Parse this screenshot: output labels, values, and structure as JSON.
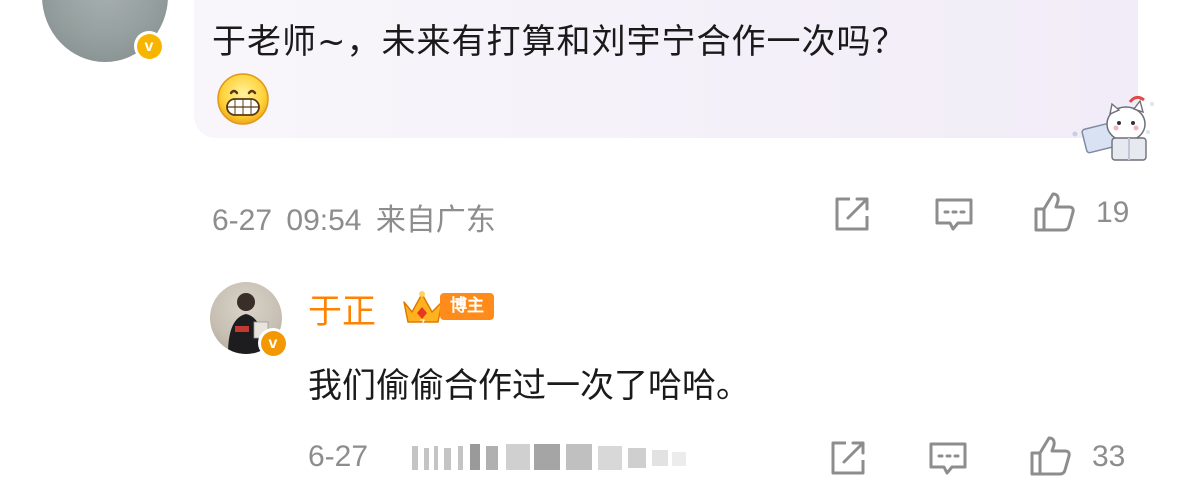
{
  "top_comment": {
    "text": "于老师~，未来有打算和刘宇宁合作一次吗？",
    "emoji": "grinning-face-emoji",
    "badge_letter": "v",
    "date": "6-27",
    "time": "09:54",
    "location": "来自广东",
    "like_count": "19"
  },
  "reply": {
    "author": "于正",
    "author_badge": "博主",
    "badge_letter": "v",
    "text": "我们偷偷合作过一次了哈哈。",
    "date": "6-27",
    "like_count": "33"
  },
  "icons": {
    "share": "share-icon",
    "comment": "comment-icon",
    "like": "thumbs-up-icon"
  },
  "colors": {
    "name_accent": "#ff8200",
    "verified": "#f7b500",
    "meta_gray": "#8d8d8d",
    "bubble_bg": "#f5f2f9"
  }
}
